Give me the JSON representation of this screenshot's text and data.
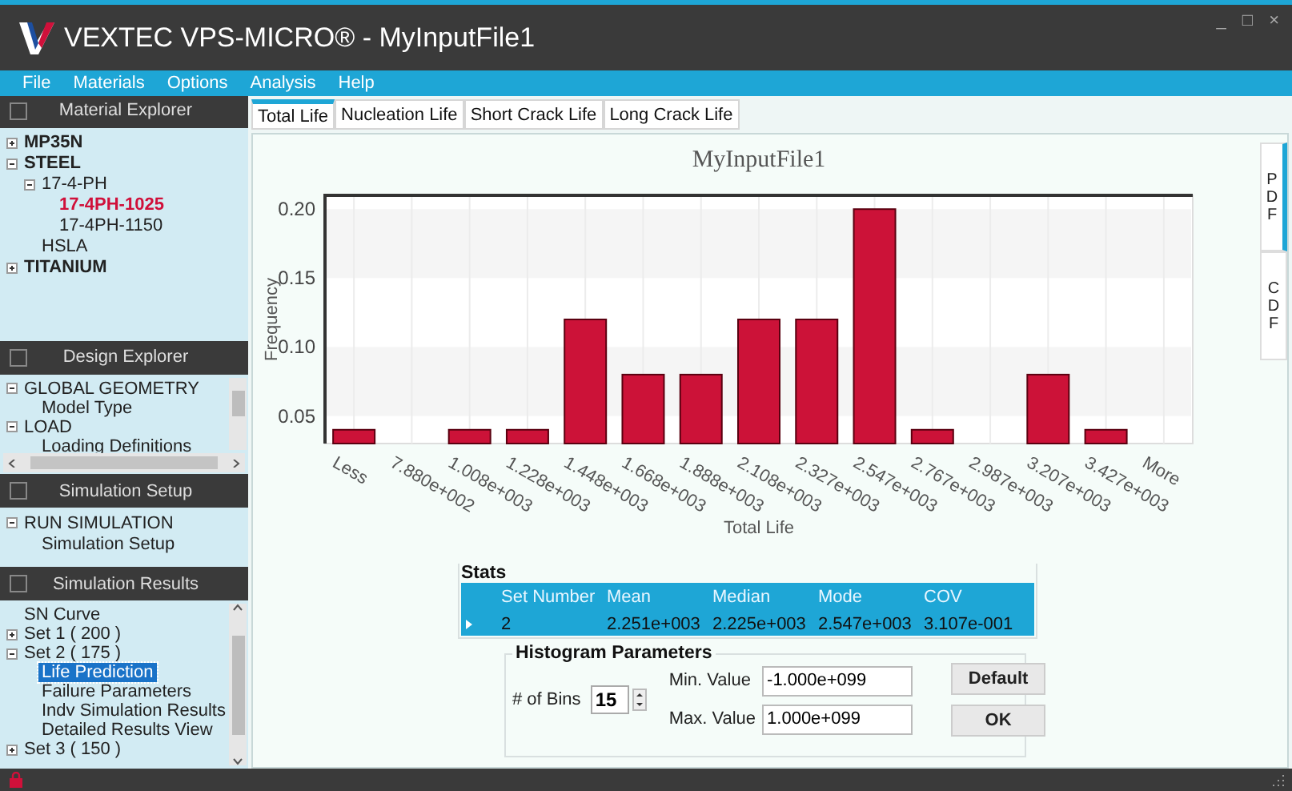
{
  "window": {
    "title": "VEXTEC VPS-MICRO® - MyInputFile1",
    "controls": [
      "_",
      "□",
      "×"
    ]
  },
  "menu": [
    "File",
    "Materials",
    "Options",
    "Analysis",
    "Help"
  ],
  "material_explorer": {
    "title": "Material Explorer",
    "checked": false,
    "items": [
      {
        "label": "MP35N",
        "expanded": false,
        "current": false
      },
      {
        "label": "STEEL",
        "expanded": true,
        "current": false,
        "children": [
          {
            "label": "17-4-PH",
            "expanded": true,
            "current": false,
            "children": [
              {
                "label": "17-4PH-1025",
                "current": true
              },
              {
                "label": "17-4PH-1150",
                "current": false
              }
            ]
          },
          {
            "label": "HSLA",
            "current": false
          }
        ]
      },
      {
        "label": "TITANIUM",
        "expanded": false,
        "current": false
      }
    ]
  },
  "design_explorer": {
    "title": "Design Explorer",
    "checked": false,
    "items": [
      {
        "label": "GLOBAL GEOMETRY",
        "expanded": true,
        "children": [
          {
            "label": "Model Type"
          }
        ]
      },
      {
        "label": "LOAD",
        "expanded": true,
        "children": [
          {
            "label": "Loading Definitions"
          }
        ]
      }
    ]
  },
  "simulation_setup": {
    "title": "Simulation Setup",
    "checked": false,
    "items": [
      {
        "label": "RUN SIMULATION",
        "expanded": true,
        "children": [
          {
            "label": "Simulation Setup"
          }
        ]
      }
    ]
  },
  "simulation_results": {
    "title": "Simulation Results",
    "checked": false,
    "items": [
      {
        "label": "SN Curve",
        "selected": false
      },
      {
        "label": "Set 1 ( 200 )",
        "expanded": false,
        "selected": false
      },
      {
        "label": "Set 2 ( 175 )",
        "expanded": true,
        "selected": false,
        "children": [
          {
            "label": "Life Prediction",
            "selected": true
          },
          {
            "label": "Failure Parameters",
            "selected": false
          },
          {
            "label": "Indv Simulation Results",
            "selected": false
          },
          {
            "label": "Detailed Results View",
            "selected": false
          }
        ]
      },
      {
        "label": "Set 3 ( 150 )",
        "expanded": false,
        "selected": false
      }
    ]
  },
  "tabs": [
    {
      "label": "Total Life",
      "selected": true
    },
    {
      "label": "Nucleation Life",
      "selected": false
    },
    {
      "label": "Short Crack Life",
      "selected": false
    },
    {
      "label": "Long Crack Life",
      "selected": false
    }
  ],
  "chart": {
    "chart_data": {
      "type": "bar",
      "title": "MyInputFile1",
      "xlabel": "Total Life",
      "ylabel": "Frequency",
      "categories": [
        "Less",
        "7.880e+002",
        "1.008e+003",
        "1.228e+003",
        "1.448e+003",
        "1.668e+003",
        "1.888e+003",
        "2.108e+003",
        "2.327e+003",
        "2.547e+003",
        "2.767e+003",
        "2.987e+003",
        "3.207e+003",
        "3.427e+003",
        "More"
      ],
      "series": [
        {
          "color": "#cc1238",
          "values": [
            0.04,
            null,
            0.04,
            0.04,
            0.12,
            0.08,
            0.08,
            0.12,
            0.12,
            0.2,
            0.04,
            null,
            0.08,
            0.04,
            null
          ]
        }
      ],
      "ylim": [
        0.03,
        0.21
      ],
      "yticks": [
        {
          "value": 0.05,
          "label": "0.05"
        },
        {
          "value": 0.1,
          "label": "0.10"
        },
        {
          "value": 0.15,
          "label": "0.15"
        },
        {
          "value": 0.2,
          "label": "0.20"
        }
      ]
    }
  },
  "view_tabs": [
    {
      "label": "PDF",
      "selected": true
    },
    {
      "label": "CDF",
      "selected": false
    }
  ],
  "stats": {
    "title": "Stats",
    "columns": [
      "Set Number",
      "Mean",
      "Median",
      "Mode",
      "COV"
    ],
    "rows": [
      {
        "selected": true,
        "cells": [
          "2",
          "2.251e+003",
          "2.225e+003",
          "2.547e+003",
          "3.107e-001"
        ]
      }
    ]
  },
  "histogram_parameters": {
    "title": "Histogram Parameters",
    "bins_label": "# of Bins",
    "bins": "15",
    "min_label": "Min. Value",
    "min": "-1.000e+099",
    "max_label": "Max. Value",
    "max": "1.000e+099",
    "buttons": [
      "Default",
      "OK"
    ]
  }
}
